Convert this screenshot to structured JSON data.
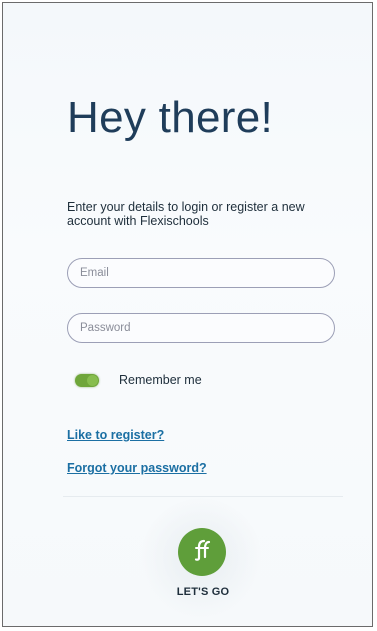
{
  "login": {
    "title": "Hey there!",
    "intro": "Enter your details to login or register a new account with Flexischools",
    "email_placeholder": "Email",
    "password_placeholder": "Password",
    "remember_label": "Remember me",
    "remember_checked": true,
    "register_link": "Like to register?",
    "forgot_link": "Forgot your password?",
    "go_label": "LET'S GO",
    "go_icon": "flexischools-logo-icon"
  },
  "colors": {
    "title": "#1f3d5a",
    "link": "#1b6fa3",
    "accent_green": "#5f9e3a"
  }
}
